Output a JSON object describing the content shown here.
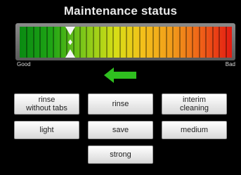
{
  "title": "Maintenance status",
  "gauge": {
    "good_label": "Good",
    "bad_label": "Bad",
    "level": 0.24
  },
  "buttons": {
    "rinse_without_tabs": "rinse\nwithout tabs",
    "rinse": "rinse",
    "interim_cleaning": "interim\ncleaning",
    "light": "light",
    "save": "save",
    "medium": "medium",
    "strong": "strong"
  },
  "colors": {
    "arrow": "#2fbf1f",
    "good": "#0a8a12",
    "bad": "#e31b12"
  }
}
